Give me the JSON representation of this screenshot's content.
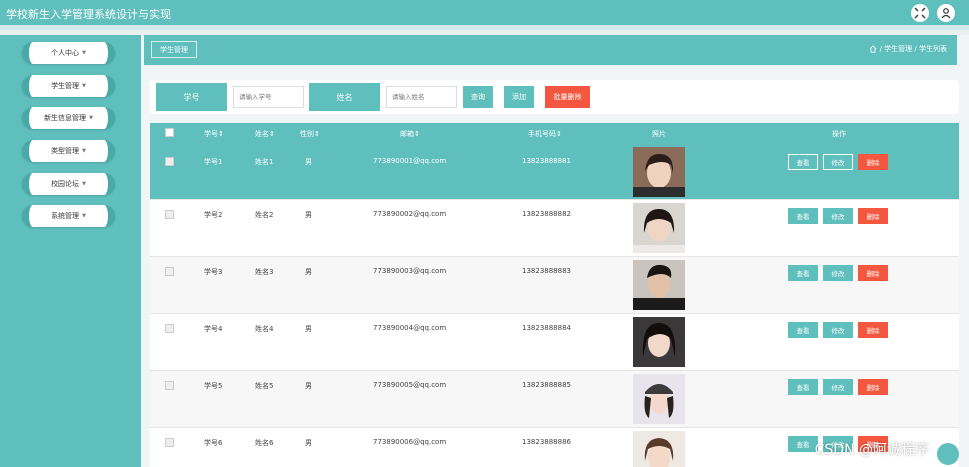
{
  "app": {
    "title": "学校新生入学管理系统设计与实现"
  },
  "topbar": {
    "icons": [
      "fullscreen-icon",
      "user-icon"
    ]
  },
  "sidebar": {
    "items": [
      {
        "label": "个人中心"
      },
      {
        "label": "学生管理"
      },
      {
        "label": "新生信息管理"
      },
      {
        "label": "类型管理"
      },
      {
        "label": "校园论坛"
      },
      {
        "label": "系统管理"
      }
    ]
  },
  "breadcrumb": {
    "tag": "学生管理",
    "path": "/ 学生管理 / 学生列表"
  },
  "search": {
    "label_id": "学号",
    "placeholder_id": "请输入学号",
    "label_name": "姓名",
    "placeholder_name": "请输入姓名",
    "query_label": "查询",
    "add_label": "添加",
    "batch_delete_label": "批量删除"
  },
  "table": {
    "headers": {
      "id": "学号",
      "name": "姓名",
      "gender": "性别",
      "email": "邮箱",
      "phone": "手机号码",
      "photo": "照片",
      "actions": "操作"
    },
    "sort_mark": "⇕",
    "action_labels": {
      "view": "查看",
      "edit": "修改",
      "delete": "删除"
    },
    "rows": [
      {
        "id": "学号1",
        "name": "姓名1",
        "gender": "男",
        "email": "773890001@qq.com",
        "phone": "13823888881"
      },
      {
        "id": "学号2",
        "name": "姓名2",
        "gender": "男",
        "email": "773890002@qq.com",
        "phone": "13823888882"
      },
      {
        "id": "学号3",
        "name": "姓名3",
        "gender": "男",
        "email": "773890003@qq.com",
        "phone": "13823888883"
      },
      {
        "id": "学号4",
        "name": "姓名4",
        "gender": "男",
        "email": "773890004@qq.com",
        "phone": "13823888884"
      },
      {
        "id": "学号5",
        "name": "姓名5",
        "gender": "男",
        "email": "773890005@qq.com",
        "phone": "13823888885"
      },
      {
        "id": "学号6",
        "name": "姓名6",
        "gender": "男",
        "email": "773890006@qq.com",
        "phone": "13823888886"
      }
    ]
  },
  "watermark": "CSDN @阿诚程序",
  "colors": {
    "primary": "#5fbfbd",
    "danger": "#f4573f",
    "selected_row": "#5fbfbd"
  }
}
